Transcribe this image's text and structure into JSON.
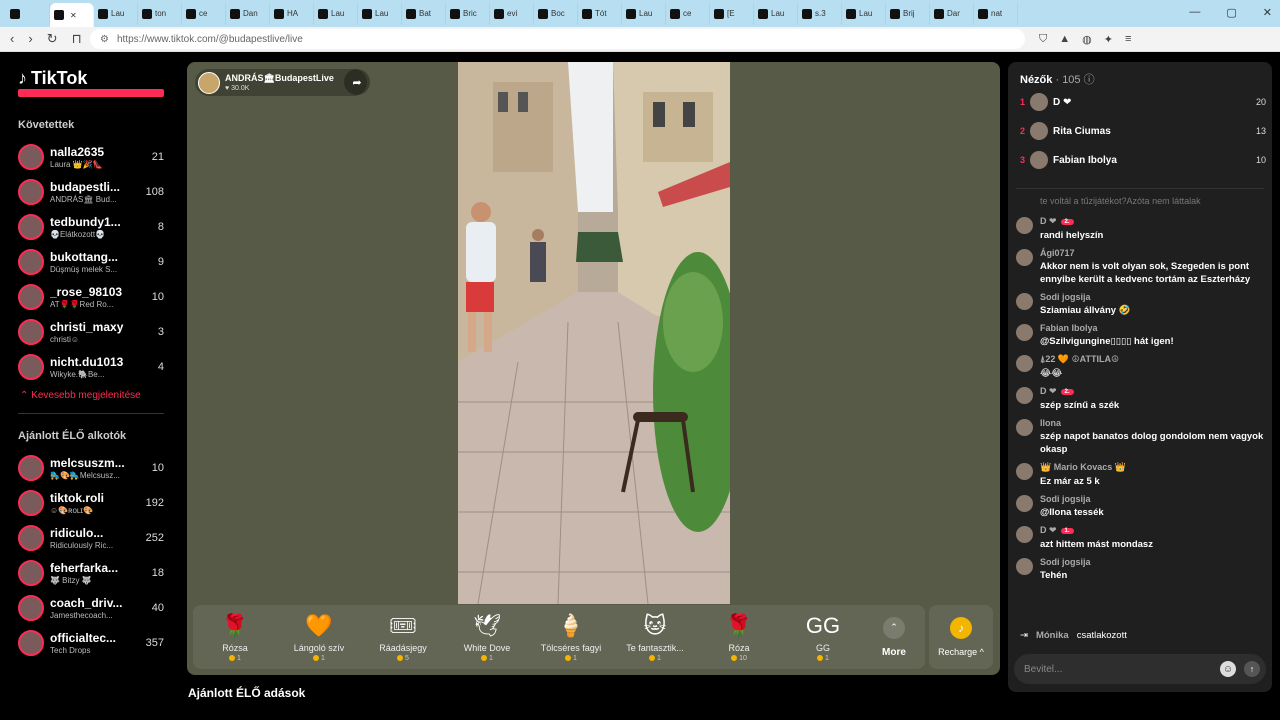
{
  "browser": {
    "tabs": [
      "Lau",
      "ton",
      "ce",
      "Dan",
      "HA",
      "Lau",
      "Lau",
      "Bat",
      "Bric",
      "evi",
      "Boc",
      "Tót",
      "Lau",
      "ce",
      "[E",
      "Lau",
      "s.3",
      "Lau",
      "Brij",
      "Dar",
      "nat"
    ],
    "active_tab_label": "",
    "url": "https://www.tiktok.com/@budapestlive/live"
  },
  "sidebar": {
    "logo": "TikTok",
    "following_title": "Követettek",
    "following": [
      {
        "name": "nalla2635",
        "sub": "Laura 👑🎉👠",
        "count": "21"
      },
      {
        "name": "budapestli...",
        "sub": "ANDRÁS🏛 Bud...",
        "count": "108"
      },
      {
        "name": "tedbundy1...",
        "sub": "💀Elátkozott💀",
        "count": "8"
      },
      {
        "name": "bukottang...",
        "sub": "Düşmüş melek S...",
        "count": "9"
      },
      {
        "name": "_rose_98103",
        "sub": "AT🌹🌹Red Ro...",
        "count": "10"
      },
      {
        "name": "christi_maxy",
        "sub": "christi☺",
        "count": "3"
      },
      {
        "name": "nicht.du1013",
        "sub": "Wikyke.🐘Be...",
        "count": "4"
      }
    ],
    "show_less": "Kevesebb megjelenítése",
    "recommended_title": "Ajánlott ÉLŐ alkotók",
    "recommended": [
      {
        "name": "melcsuszm...",
        "sub": "🛼🎨🛼Melcsusz...",
        "count": "10"
      },
      {
        "name": "tiktok.roli",
        "sub": "☺🎨ʀᴏʟɪ🎨",
        "count": "192"
      },
      {
        "name": "ridiculo...",
        "sub": "Ridiculously Ric...",
        "count": "252"
      },
      {
        "name": "feherfarka...",
        "sub": "🐺 Bitzy 🐺",
        "count": "18"
      },
      {
        "name": "coach_driv...",
        "sub": "Jamesthecoach...",
        "count": "40"
      },
      {
        "name": "officialtec...",
        "sub": "Tech Drops",
        "count": "357"
      }
    ]
  },
  "stream": {
    "host_name": "ANDRÁS🏛BudapestLive",
    "host_likes": "♥ 30.0K",
    "gifts": [
      {
        "icon": "🌹",
        "name": "Rózsa",
        "price": "1"
      },
      {
        "icon": "🧡",
        "name": "Lángoló szív",
        "price": "1"
      },
      {
        "icon": "🎟",
        "name": "Ráadásjegy",
        "price": "5"
      },
      {
        "icon": "🕊",
        "name": "White Dove",
        "price": "1"
      },
      {
        "icon": "🍦",
        "name": "Tölcséres fagyi",
        "price": "1"
      },
      {
        "icon": "🐱",
        "name": "Te fantasztik...",
        "price": "1"
      },
      {
        "icon": "🌹",
        "name": "Róza",
        "price": "10"
      },
      {
        "icon": "GG",
        "name": "GG",
        "price": "1"
      }
    ],
    "more_label": "More",
    "recharge_label": "Recharge ^"
  },
  "recommended_lives_title": "Ajánlott ÉLŐ adások",
  "chat": {
    "viewers_label": "Nézők",
    "viewers_count": "· 105",
    "top_viewers": [
      {
        "rank": "1",
        "name": "D ❤",
        "score": "20"
      },
      {
        "rank": "2",
        "name": "Rita Ciumas",
        "score": "13"
      },
      {
        "rank": "3",
        "name": "Fabian Ibolya",
        "score": "10"
      }
    ],
    "faded_message": "te voltál a tűzijátékot?Azóta nem láttalak",
    "messages": [
      {
        "name": "D ❤",
        "badge": "2.",
        "text": "randi helyszín"
      },
      {
        "name": "Ági0717",
        "badge": "",
        "text": "Akkor nem is volt olyan sok, Szegeden is pont ennyibe került a kedvenc tortám az Eszterházy"
      },
      {
        "name": "Sodi jogsija",
        "badge": "",
        "text": "Sziamiau állvány 🤣"
      },
      {
        "name": "Fabian Ibolya",
        "badge": "",
        "text": "@Szilvigungine▯▯▯▯ hát igen!"
      },
      {
        "name": "⍋22 🧡 ☮ATTILA☮",
        "badge": "",
        "text": "😂😂"
      },
      {
        "name": "D ❤",
        "badge": "2.",
        "text": "szép színű a szék"
      },
      {
        "name": "Ilona",
        "badge": "",
        "text": "szép napot banatos dolog gondolom nem vagyok okasp"
      },
      {
        "name": "👑 Mario Kovacs 👑",
        "badge": "",
        "text": "Ez már az 5 k"
      },
      {
        "name": "Sodi jogsija",
        "badge": "",
        "text": "@Ilona tessék"
      },
      {
        "name": "D ❤",
        "badge": "1.",
        "text": "azt hittem mást mondasz"
      },
      {
        "name": "Sodi jogsija",
        "badge": "",
        "text": "Tehén"
      }
    ],
    "joined_name": "Mónika",
    "joined_text": "csatlakozott",
    "input_placeholder": "Bevitel..."
  }
}
